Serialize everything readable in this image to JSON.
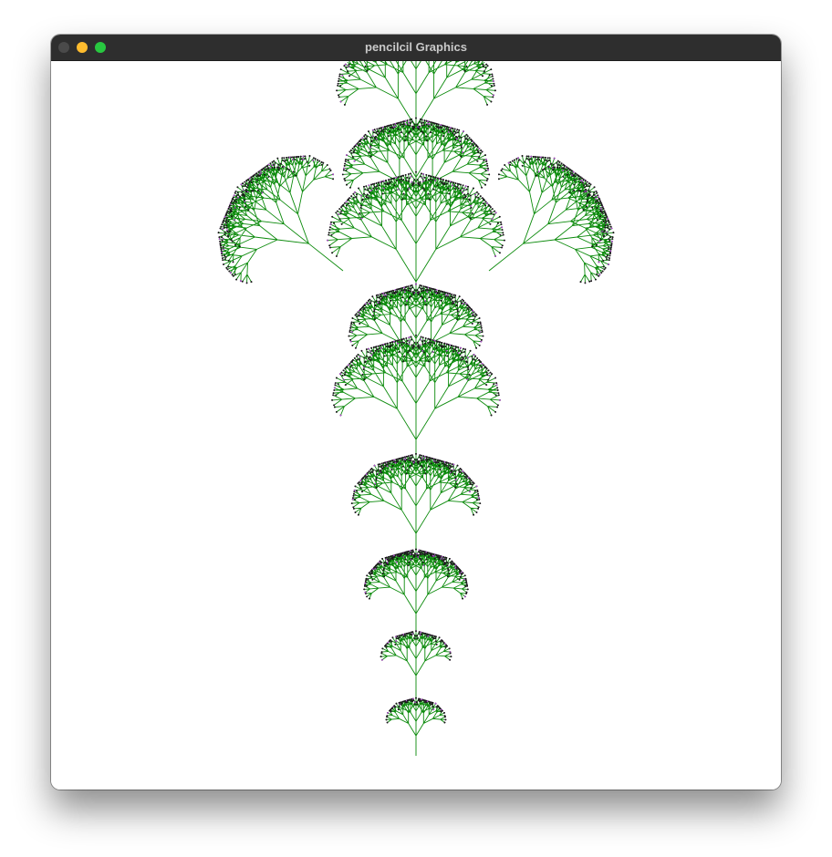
{
  "window": {
    "title": "pencilcil Graphics",
    "controls": {
      "close_icon": "close-icon",
      "minimize_icon": "minimize-icon",
      "zoom_icon": "zoom-icon"
    }
  },
  "canvas": {
    "content": "fractal-tree",
    "colors": {
      "branch": "#0b8a0b",
      "accent": "#b24bd0",
      "background": "#ffffff"
    }
  }
}
